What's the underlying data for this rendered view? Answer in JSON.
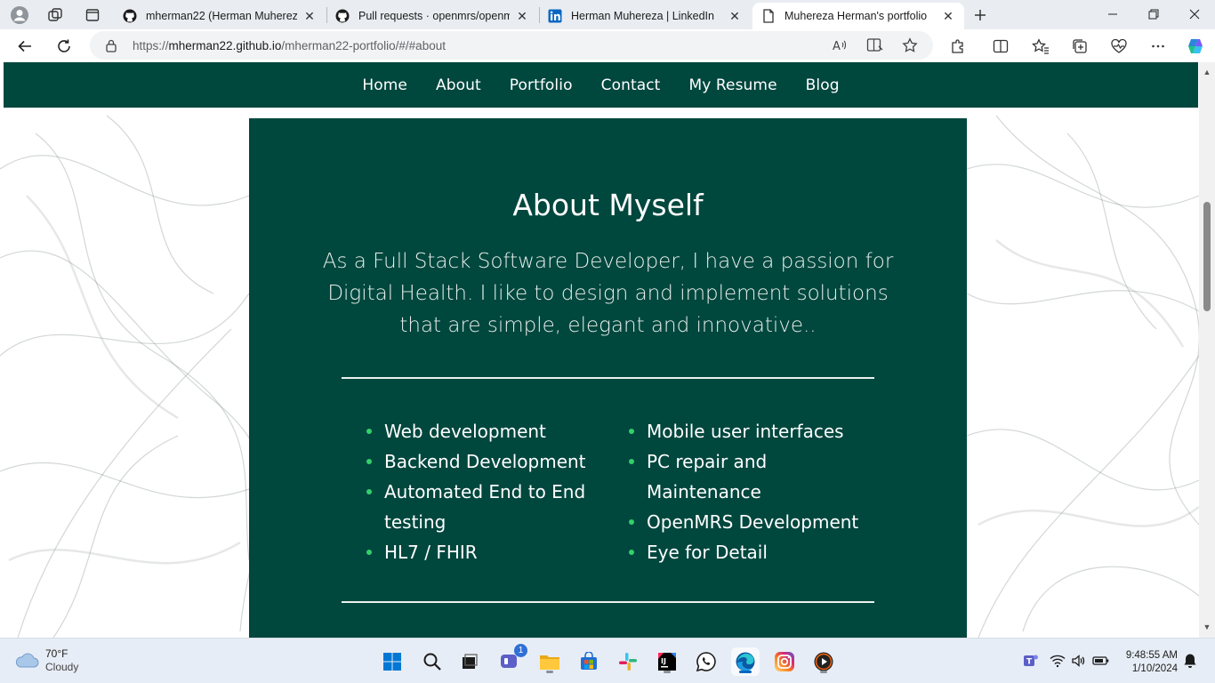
{
  "browser": {
    "tabs": [
      {
        "title": "mherman22 (Herman Muhereza)",
        "icon": "github-icon"
      },
      {
        "title": "Pull requests · openmrs/openmrs",
        "icon": "github-icon"
      },
      {
        "title": "Herman Muhereza | LinkedIn",
        "icon": "linkedin-icon"
      },
      {
        "title": "Muhereza Herman's portfolio",
        "icon": "page-icon"
      }
    ],
    "url_prefix": "https://",
    "url_domain": "mherman22.github.io",
    "url_path": "/mherman22-portfolio/#/#about"
  },
  "site": {
    "nav": [
      "Home",
      "About",
      "Portfolio",
      "Contact",
      "My Resume",
      "Blog"
    ],
    "about_title": "About Myself",
    "about_intro": "As a Full Stack Software Developer, I have a passion for Digital Health. I like to design and implement solutions that are simple, elegant and innovative..",
    "skills_left": [
      "Web development",
      "Backend Development",
      "Automated End to End testing",
      "HL7 / FHIR"
    ],
    "skills_right": [
      "Mobile user interfaces",
      "PC repair and Maintenance",
      "OpenMRS Development",
      "Eye for Detail"
    ]
  },
  "taskbar": {
    "temperature": "70°F",
    "condition": "Cloudy",
    "time": "9:48:55 AM",
    "date": "1/10/2024",
    "teams_badge": "1"
  },
  "colors": {
    "brand": "#00473e",
    "bullet": "#33d06a",
    "edge_accent": "#0067c0"
  }
}
